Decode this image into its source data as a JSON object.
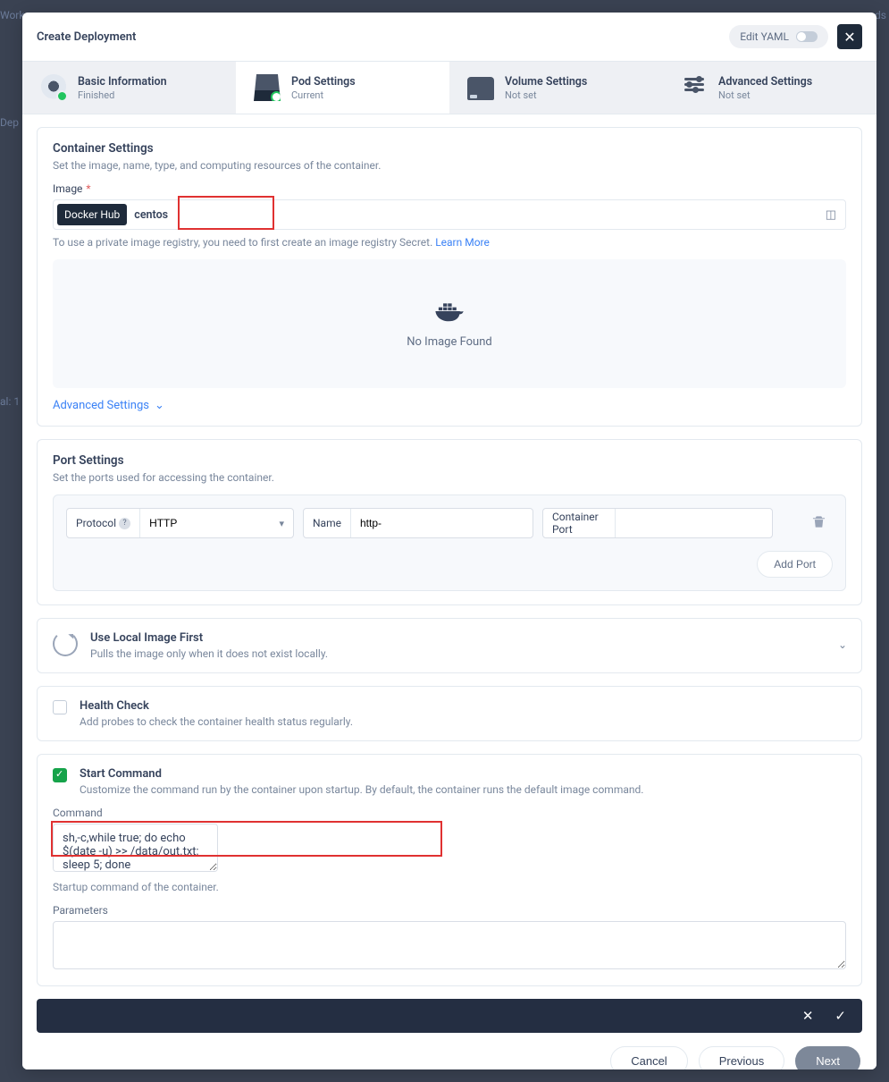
{
  "bg": {
    "t1": "Work",
    "t2": "Dep",
    "t3": "al: 1",
    "t5": "ds"
  },
  "header": {
    "title": "Create Deployment",
    "edit_yaml": "Edit YAML"
  },
  "steps": {
    "basic": {
      "title": "Basic Information",
      "sub": "Finished"
    },
    "pod": {
      "title": "Pod Settings",
      "sub": "Current"
    },
    "volume": {
      "title": "Volume Settings",
      "sub": "Not set"
    },
    "advanced": {
      "title": "Advanced Settings",
      "sub": "Not set"
    }
  },
  "container": {
    "title": "Container Settings",
    "desc": "Set the image, name, type, and computing resources of the container.",
    "image_label": "Image",
    "docker_hub": "Docker Hub",
    "image_value": "centos",
    "hint_pre": "To use a private image registry, you need to first create an image registry Secret. ",
    "learn_more": "Learn More",
    "no_image": "No Image Found",
    "adv_link": "Advanced Settings"
  },
  "ports": {
    "title": "Port Settings",
    "desc": "Set the ports used for accessing the container.",
    "protocol_label": "Protocol",
    "protocol_value": "HTTP",
    "name_label": "Name",
    "name_value": "http-",
    "cport_label": "Container Port",
    "cport_value": "",
    "add_port": "Add Port"
  },
  "local": {
    "title": "Use Local Image First",
    "desc": "Pulls the image only when it does not exist locally."
  },
  "health": {
    "title": "Health Check",
    "desc": "Add probes to check the container health status regularly."
  },
  "start": {
    "title": "Start Command",
    "desc": "Customize the command run by the container upon startup. By default, the container runs the default image command.",
    "command_label": "Command",
    "command_value": "sh,-c,while true; do echo $(date -u) >> /data/out.txt; sleep 5; done",
    "command_help": "Startup command of the container.",
    "params_label": "Parameters",
    "params_value": ""
  },
  "footer": {
    "cancel": "Cancel",
    "previous": "Previous",
    "next": "Next"
  }
}
